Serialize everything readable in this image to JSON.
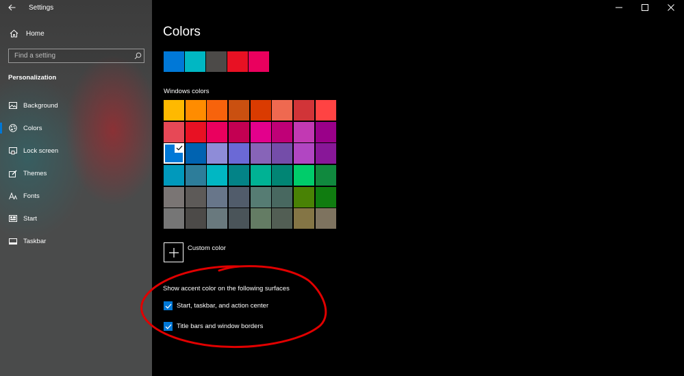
{
  "window": {
    "app_title": "Settings",
    "controls": [
      "minimize-icon",
      "maximize-icon",
      "close-icon"
    ]
  },
  "sidebar": {
    "home_label": "Home",
    "search_placeholder": "Find a setting",
    "section_title": "Personalization",
    "items": [
      {
        "label": "Background",
        "icon": "picture-icon"
      },
      {
        "label": "Colors",
        "icon": "palette-icon",
        "active": true
      },
      {
        "label": "Lock screen",
        "icon": "lock-screen-icon"
      },
      {
        "label": "Themes",
        "icon": "brush-icon"
      },
      {
        "label": "Fonts",
        "icon": "font-icon"
      },
      {
        "label": "Start",
        "icon": "start-icon"
      },
      {
        "label": "Taskbar",
        "icon": "taskbar-icon"
      }
    ]
  },
  "main": {
    "title": "Colors",
    "recent_colors": [
      "#0078d7",
      "#00b7c3",
      "#4c4a48",
      "#e81123",
      "#ea005e"
    ],
    "windows_colors_label": "Windows colors",
    "windows_colors": [
      [
        "#ffb900",
        "#ff8c00",
        "#f7630c",
        "#ca5010",
        "#da3b01",
        "#ef6950",
        "#d13438",
        "#ff4343"
      ],
      [
        "#e74856",
        "#e81123",
        "#ea005e",
        "#c30052",
        "#e3008c",
        "#bf0077",
        "#c239b3",
        "#9a0089"
      ],
      [
        "#0078d7",
        "#0063b1",
        "#8e8cd8",
        "#6b69d6",
        "#8764b8",
        "#744da9",
        "#b146c2",
        "#881798"
      ],
      [
        "#0099bc",
        "#2d7d9a",
        "#00b7c3",
        "#038387",
        "#00b294",
        "#018574",
        "#00cc6a",
        "#10893e"
      ],
      [
        "#7a7574",
        "#5d5a58",
        "#68768a",
        "#515c6b",
        "#567c73",
        "#486860",
        "#498205",
        "#107c10"
      ],
      [
        "#767676",
        "#4c4a48",
        "#69797e",
        "#4a5459",
        "#647c64",
        "#525e54",
        "#847545",
        "#7e735f"
      ]
    ],
    "selected_color": "#0078d7",
    "custom_color_label": "Custom color",
    "surfaces_label": "Show accent color on the following surfaces",
    "checkboxes": [
      {
        "label": "Start, taskbar, and action center",
        "checked": true
      },
      {
        "label": "Title bars and window borders",
        "checked": true
      }
    ],
    "annotation_color": "#e00000"
  }
}
